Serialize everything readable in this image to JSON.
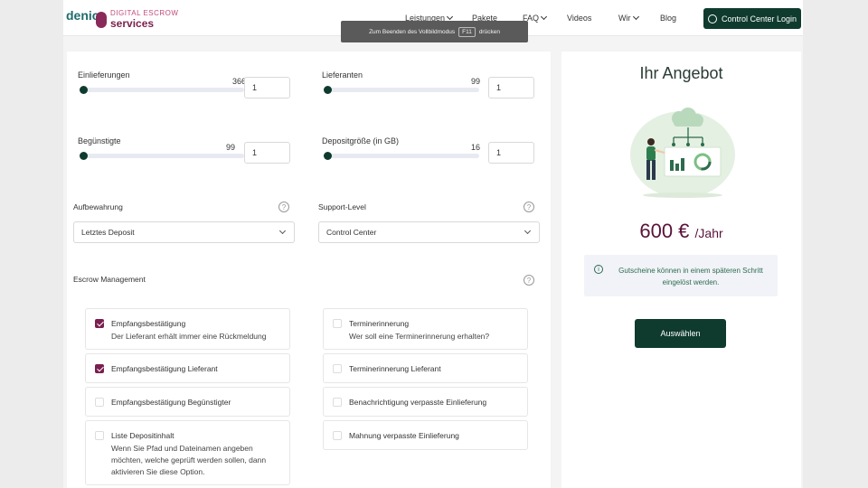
{
  "header": {
    "logo_main": "denic",
    "logo_sub_top": "DIGITAL ESCROW",
    "logo_sub": "services",
    "nav": [
      {
        "label": "Leistungen",
        "has_dropdown": true
      },
      {
        "label": "Pakete",
        "has_dropdown": false
      },
      {
        "label": "FAQ",
        "has_dropdown": true
      },
      {
        "label": "Videos",
        "has_dropdown": false
      },
      {
        "label": "Wir",
        "has_dropdown": true
      },
      {
        "label": "Blog",
        "has_dropdown": false
      }
    ],
    "login_label": "Control Center Login",
    "fullscreen_hint": {
      "before": "Zum Beenden des Vollbildmodus",
      "key": "F11",
      "after": "drücken"
    }
  },
  "config": {
    "sliders": [
      {
        "label": "Einlieferungen",
        "max_label": "366",
        "input_value": "1",
        "level": 0.0
      },
      {
        "label": "Lieferanten",
        "max_label": "99",
        "input_value": "1",
        "level": 0.0
      },
      {
        "label": "Begünstigte",
        "max_label": "99",
        "input_value": "1",
        "level": 0.0
      },
      {
        "label": "Depositgröße (in GB)",
        "max_label": "16",
        "input_value": "1",
        "level": 0.0
      }
    ],
    "retention": {
      "label": "Aufbewahrung",
      "value": "Letztes Deposit"
    },
    "support": {
      "label": "Support-Level",
      "value": "Control Center"
    },
    "escrow_title": "Escrow Management",
    "help_symbol": "?",
    "options_left": [
      {
        "title": "Empfangsbestätigung",
        "desc": "Der Lieferant erhält immer eine Rückmeldung",
        "checked": true
      },
      {
        "title": "Empfangsbestätigung Lieferant",
        "desc": "",
        "checked": true
      },
      {
        "title": "Empfangsbestätigung Begünstigter",
        "desc": "",
        "checked": false
      },
      {
        "title": "Liste Depositinhalt",
        "desc": "Wenn Sie Pfad und Dateinamen angeben möchten, welche geprüft werden sollen, dann aktivieren Sie diese Option.",
        "checked": false
      }
    ],
    "options_right": [
      {
        "title": "Terminerinnerung",
        "desc": "Wer soll eine Terminerinnerung erhalten?",
        "checked": false
      },
      {
        "title": "Terminerinnerung Lieferant",
        "desc": "",
        "checked": false
      },
      {
        "title": "Benachrichtigung verpasste Einlieferung",
        "desc": "",
        "checked": false
      },
      {
        "title": "Mahnung verpasste Einlieferung",
        "desc": "",
        "checked": false
      }
    ]
  },
  "offer": {
    "title": "Ihr Angebot",
    "price": "600 €",
    "price_unit": "/Jahr",
    "info_text": "Gutscheine können in einem späteren Schritt eingelöst werden.",
    "select_label": "Auswählen"
  },
  "colors": {
    "primary": "#0f3b2e",
    "accent": "#7a1f4f",
    "price": "#5a1238"
  }
}
